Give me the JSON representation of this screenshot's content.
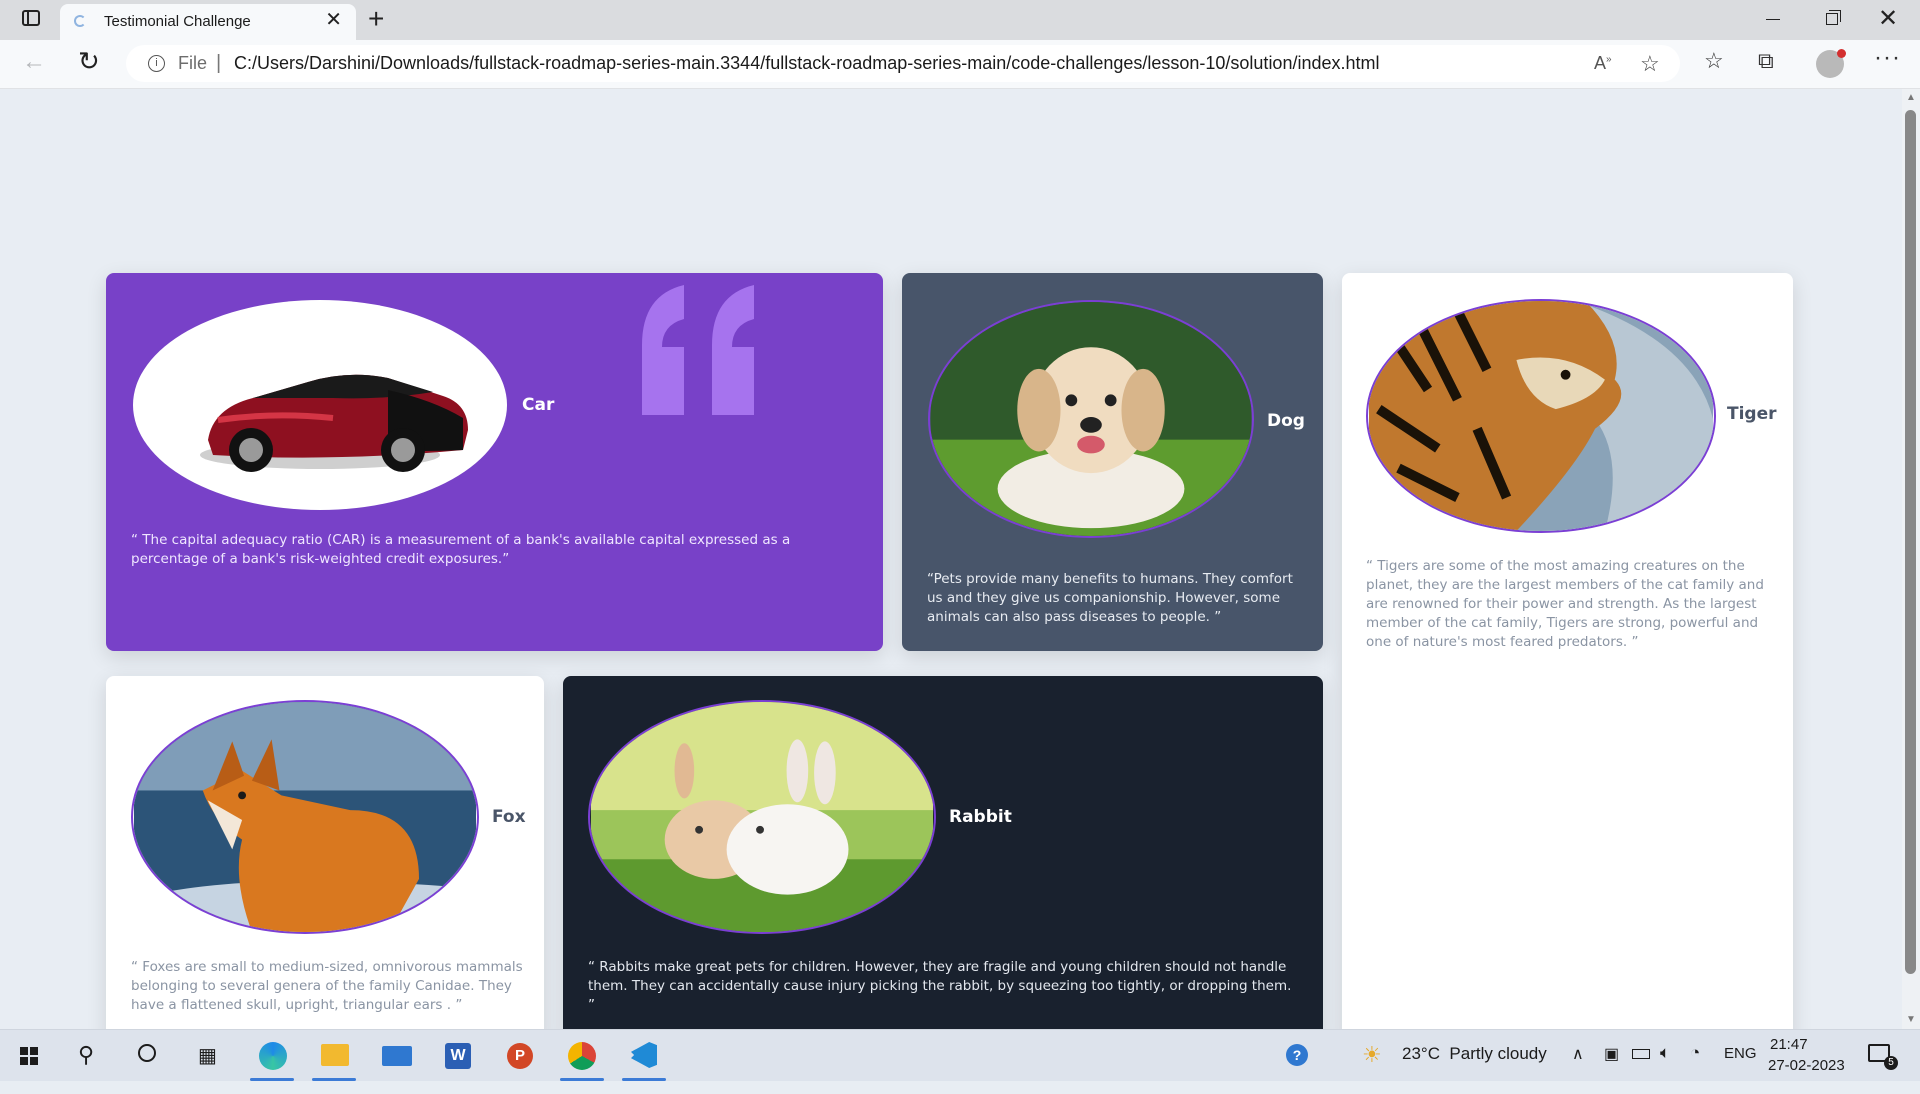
{
  "browser": {
    "tab_title": "Testimonial Challenge",
    "file_label": "File",
    "url": "C:/Users/Darshini/Downloads/fullstack-roadmap-series-main.3344/fullstack-roadmap-series-main/code-challenges/lesson-10/solution/index.html"
  },
  "cards": {
    "car": {
      "name": "Car",
      "quote": "“ The capital adequacy ratio (CAR) is a measurement of a bank's available capital expressed as a percentage of a bank's risk-weighted credit exposures.”",
      "bg": "#7841c8"
    },
    "dog": {
      "name": "Dog",
      "quote": "“Pets provide many benefits to humans. They comfort us and they give us companionship. However, some animals can also pass diseases to people. ”",
      "bg": "#48556a"
    },
    "tiger": {
      "name": "Tiger",
      "quote": "“ Tigers are some of the most amazing creatures on the planet, they are the largest members of the cat family and are renowned for their power and strength. As the largest member of the cat family, Tigers are strong, powerful and one of nature's most feared predators. ”",
      "bg": "#ffffff"
    },
    "fox": {
      "name": "Fox",
      "quote": "“ Foxes are small to medium-sized, omnivorous mammals belonging to several genera of the family Canidae. They have a flattened skull, upright, triangular ears . ”",
      "bg": "#ffffff"
    },
    "rabbit": {
      "name": "Rabbit",
      "quote": "“ Rabbits make great pets for children. However, they are fragile and young children should not handle them. They can accidentally cause injury picking the rabbit, by squeezing too tightly, or dropping them. ”",
      "bg": "#19212e"
    }
  },
  "taskbar": {
    "weather": "23°C  Partly cloudy",
    "language": "ENG",
    "time": "21:47",
    "date": "27-02-2023",
    "notification_count": "5"
  },
  "colors": {
    "accent_purple": "#7841c8",
    "oval_border": "#7b3fd4"
  }
}
